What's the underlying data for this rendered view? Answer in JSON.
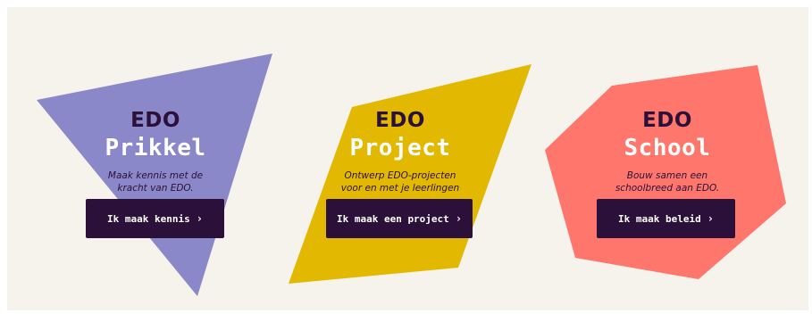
{
  "colors": {
    "background": "#f6f2ec",
    "prikkel_shape": "#8b88c9",
    "project_shape": "#e3b800",
    "school_shape": "#ff766d",
    "dark_text": "#2b1139",
    "button": "#2b1139"
  },
  "cards": [
    {
      "brand": "EDO",
      "name": "Prikkel",
      "description": "Maak kennis met de\nkracht van EDO.",
      "button_label": "Ik maak kennis",
      "button_icon": "chevron-right-icon"
    },
    {
      "brand": "EDO",
      "name": "Project",
      "description": "Ontwerp EDO-projecten\nvoor en met je leerlingen",
      "button_label": "Ik maak een project",
      "button_icon": "chevron-right-icon"
    },
    {
      "brand": "EDO",
      "name": "School",
      "description": "Bouw samen een\nschoolbreed aan EDO.",
      "button_label": "Ik maak beleid",
      "button_icon": "chevron-right-icon"
    }
  ]
}
